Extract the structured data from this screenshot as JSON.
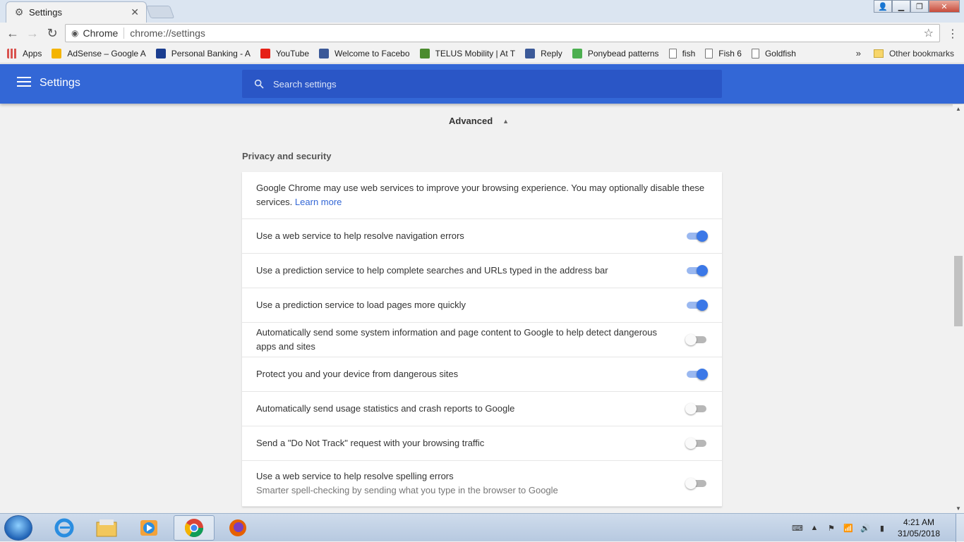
{
  "browser": {
    "tab_title": "Settings",
    "omnibox_label": "Chrome",
    "url": "chrome://settings"
  },
  "bookmarks": {
    "items": [
      {
        "label": "Apps",
        "icon": "apps-grid-icon",
        "color": "#d9534f"
      },
      {
        "label": "AdSense – Google A",
        "icon": "adsense-icon",
        "color": "#f4b400"
      },
      {
        "label": "Personal Banking - A",
        "icon": "bank-icon",
        "color": "#1a3d8f"
      },
      {
        "label": "YouTube",
        "icon": "youtube-icon",
        "color": "#e62117"
      },
      {
        "label": "Welcome to Facebo",
        "icon": "facebook-icon",
        "color": "#3b5998"
      },
      {
        "label": "TELUS Mobility | At T",
        "icon": "telus-icon",
        "color": "#4b8b2e"
      },
      {
        "label": "Reply",
        "icon": "facebook-icon",
        "color": "#3b5998"
      },
      {
        "label": "Ponybead patterns",
        "icon": "smiley-icon",
        "color": "#4caf50"
      },
      {
        "label": "fish",
        "icon": "page-icon",
        "color": "#ffffff"
      },
      {
        "label": "Fish 6",
        "icon": "page-icon",
        "color": "#ffffff"
      },
      {
        "label": "Goldfish",
        "icon": "page-icon",
        "color": "#ffffff"
      }
    ],
    "overflow": "»",
    "other": "Other bookmarks"
  },
  "appbar": {
    "title": "Settings",
    "search_placeholder": "Search settings",
    "color": "#3367d6"
  },
  "advanced_label": "Advanced",
  "section_title": "Privacy and security",
  "intro": {
    "text": "Google Chrome may use web services to improve your browsing experience. You may optionally disable these services.",
    "link": "Learn more"
  },
  "settings": [
    {
      "label": "Use a web service to help resolve navigation errors",
      "on": true
    },
    {
      "label": "Use a prediction service to help complete searches and URLs typed in the address bar",
      "on": true
    },
    {
      "label": "Use a prediction service to load pages more quickly",
      "on": true
    },
    {
      "label": "Automatically send some system information and page content to Google to help detect dangerous apps and sites",
      "on": false
    },
    {
      "label": "Protect you and your device from dangerous sites",
      "on": true
    },
    {
      "label": "Automatically send usage statistics and crash reports to Google",
      "on": false
    },
    {
      "label": "Send a \"Do Not Track\" request with your browsing traffic",
      "on": false
    },
    {
      "label": "Use a web service to help resolve spelling errors",
      "sub": "Smarter spell-checking by sending what you type in the browser to Google",
      "on": false
    }
  ],
  "taskbar": {
    "time": "4:21 AM",
    "date": "31/05/2018"
  }
}
